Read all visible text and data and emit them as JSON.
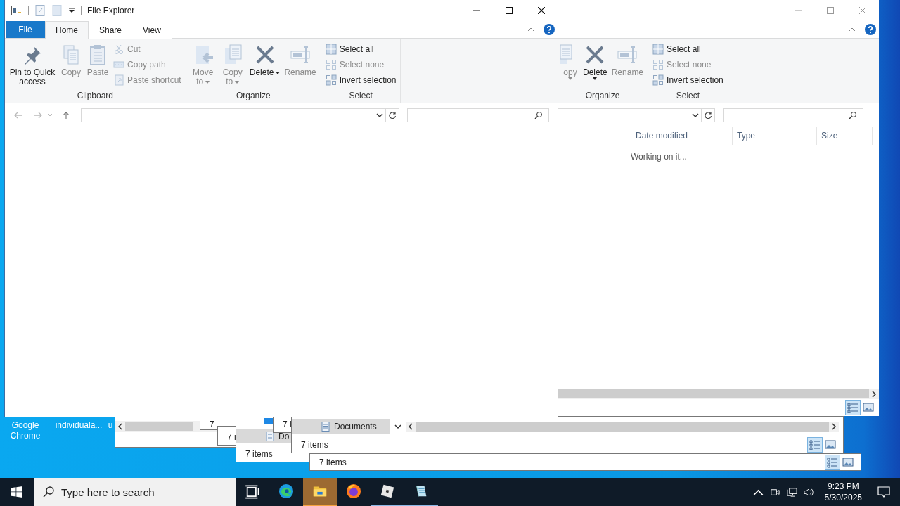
{
  "desktop_icons": [
    {
      "label": "Google Chrome"
    },
    {
      "label": "individuala..."
    },
    {
      "label": "u"
    }
  ],
  "stacked_windows": [
    {
      "status": "7"
    },
    {
      "status": "7 i"
    },
    {
      "status": "7 i"
    },
    {
      "status": "7 items",
      "item": "Documents"
    },
    {
      "status": "7 items",
      "item": "Do"
    },
    {
      "status": "7 items"
    }
  ],
  "back_window": {
    "ribbon": [
      {
        "label": "Organize",
        "items": [
          {
            "kind": "large",
            "label": "opy",
            "disabled": true,
            "menu": true
          },
          {
            "kind": "large",
            "label": "Delete",
            "disabled": false,
            "menu": true
          },
          {
            "kind": "large",
            "label": "Rename",
            "disabled": true,
            "menu": false
          }
        ]
      },
      {
        "label": "Select",
        "items": [
          {
            "kind": "small",
            "label": "Select all",
            "disabled": false
          },
          {
            "kind": "small",
            "label": "Select none",
            "disabled": true
          },
          {
            "kind": "small",
            "label": "Invert selection",
            "disabled": false
          }
        ]
      }
    ],
    "columns": [
      "Date modified",
      "Type",
      "Size"
    ],
    "message": "Working on it..."
  },
  "main_window": {
    "title": "File Explorer",
    "file_menu": "File",
    "tabs": [
      {
        "label": "Home",
        "selected": true
      },
      {
        "label": "Share",
        "selected": false
      },
      {
        "label": "View",
        "selected": false
      }
    ],
    "ribbon": [
      {
        "label": "Clipboard",
        "items": [
          {
            "kind": "large",
            "label": "Pin to Quick access",
            "disabled": false,
            "menu": false
          },
          {
            "kind": "large",
            "label": "Copy",
            "disabled": true,
            "menu": false
          },
          {
            "kind": "large",
            "label": "Paste",
            "disabled": true,
            "menu": false
          },
          {
            "kind": "small",
            "label": "Cut",
            "disabled": true
          },
          {
            "kind": "small",
            "label": "Copy path",
            "disabled": true
          },
          {
            "kind": "small",
            "label": "Paste shortcut",
            "disabled": true
          }
        ]
      },
      {
        "label": "Organize",
        "items": [
          {
            "kind": "large",
            "label": "Move to",
            "disabled": true,
            "menu": true
          },
          {
            "kind": "large",
            "label": "Copy to",
            "disabled": true,
            "menu": true
          },
          {
            "kind": "large",
            "label": "Delete",
            "disabled": false,
            "menu": true
          },
          {
            "kind": "large",
            "label": "Rename",
            "disabled": true,
            "menu": false
          }
        ]
      },
      {
        "label": "Select",
        "items": [
          {
            "kind": "small",
            "label": "Select all",
            "disabled": false
          },
          {
            "kind": "small",
            "label": "Select none",
            "disabled": true
          },
          {
            "kind": "small",
            "label": "Invert selection",
            "disabled": false
          }
        ]
      }
    ]
  },
  "taskbar": {
    "search_placeholder": "Type here to search",
    "apps": [
      {
        "kind": "edge",
        "selected": false,
        "running": false
      },
      {
        "kind": "explorer",
        "selected": true,
        "running": true
      },
      {
        "kind": "firefox",
        "selected": false,
        "running": false
      },
      {
        "kind": "roblox",
        "selected": false,
        "running": true
      },
      {
        "kind": "notepad",
        "selected": false,
        "running": true
      }
    ],
    "time": "9:23 PM",
    "date": "5/30/2025"
  }
}
